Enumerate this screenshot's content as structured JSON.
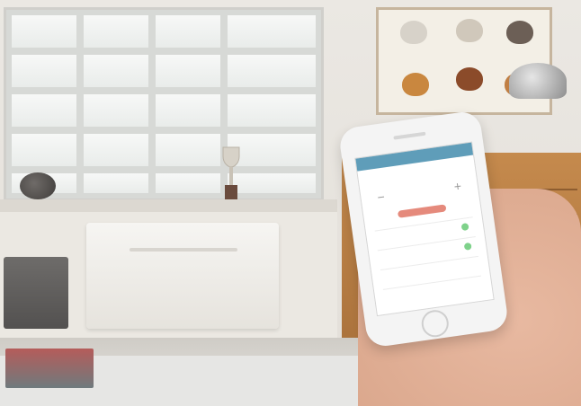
{
  "scene": {
    "colors": {
      "wall": "#e9e6e1",
      "dresser": "#b7773f",
      "accent_blue": "#5f9db9",
      "accent_red": "#e58a7c",
      "accent_green": "#7fd28b"
    }
  }
}
